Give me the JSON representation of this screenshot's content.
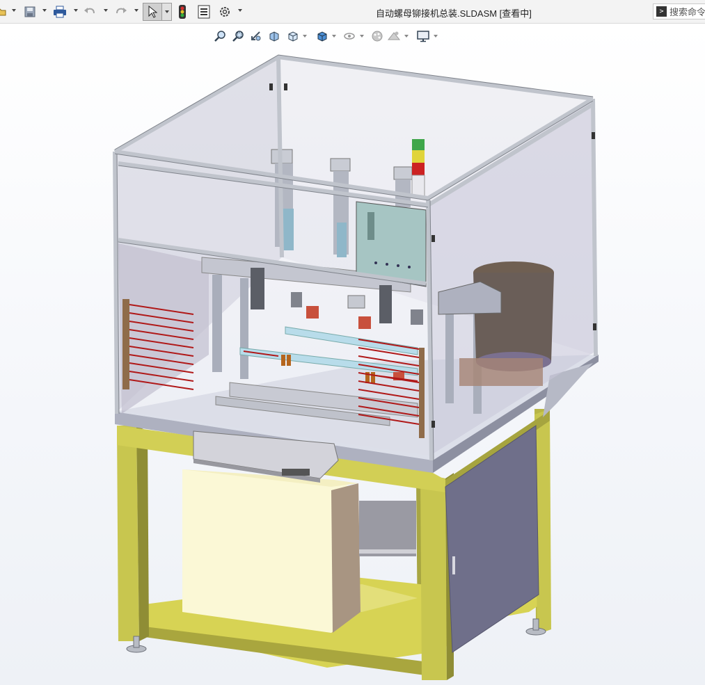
{
  "window": {
    "title": "自动螺母铆接机总装.SLDASM [查看中]"
  },
  "toolbar": {
    "icons": [
      "open-icon",
      "save-icon",
      "print-icon",
      "undo-icon",
      "redo-icon",
      "select-icon",
      "rebuild-icon",
      "file-properties-icon",
      "options-icon"
    ]
  },
  "search": {
    "placeholder": "搜索命令"
  },
  "heads_up_toolbar": {
    "icons": [
      "zoom-to-fit-icon",
      "zoom-to-area-icon",
      "previous-view-icon",
      "section-view-icon",
      "view-orientation-icon",
      "display-style-icon",
      "hide-show-items-icon",
      "edit-appearance-icon",
      "apply-scene-icon",
      "view-settings-icon"
    ]
  },
  "model": {
    "name": "automatic-nut-riveting-machine-assembly",
    "colors": {
      "frame": "#c9c84e",
      "frame_shadow": "#8f8d35",
      "table": "#d9dce6",
      "enclosure": "#c6c8d6",
      "aluminum": "#c0c4cc",
      "box": "#fbf8d6",
      "cabinet": "#6f6f8a",
      "sensor": "#b01818",
      "glass": "#e6e8f0"
    }
  }
}
